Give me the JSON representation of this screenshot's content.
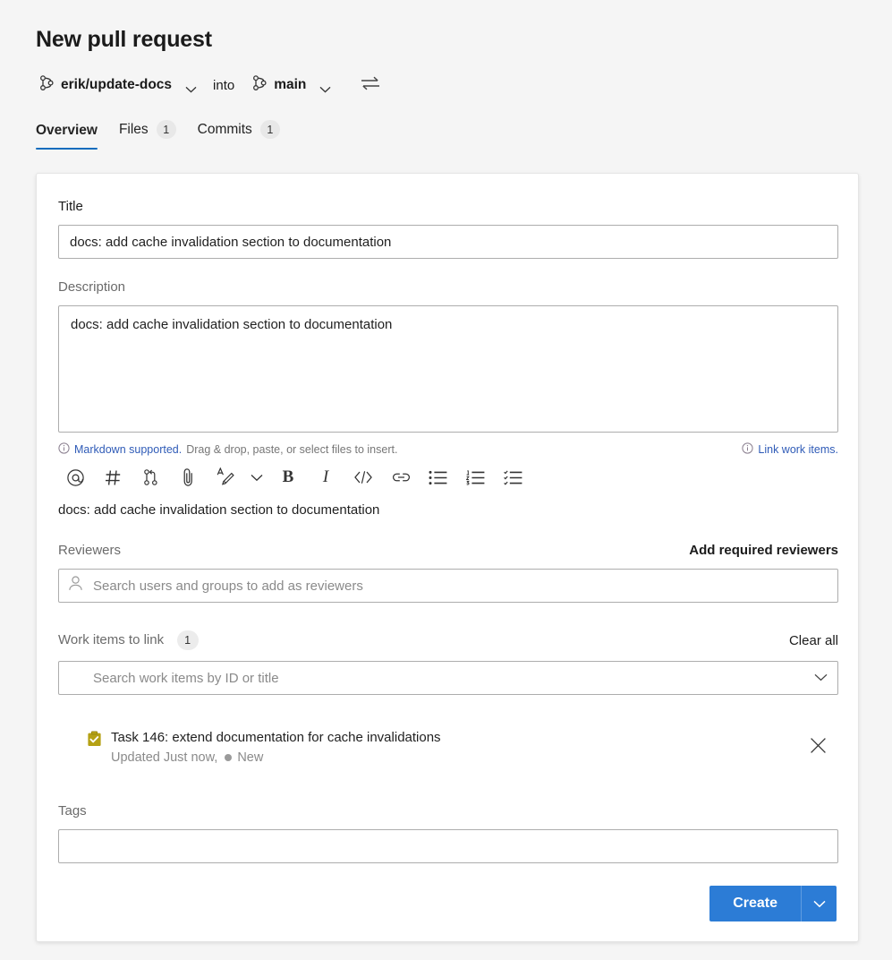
{
  "header": {
    "title": "New pull request",
    "source_branch": "erik/update-docs",
    "into_label": "into",
    "target_branch": "main",
    "source_icon": "branch-icon",
    "target_icon": "branch-icon",
    "swap_icon": "swap-arrows-icon"
  },
  "tabs": [
    {
      "label": "Overview",
      "count": "",
      "active": true
    },
    {
      "label": "Files",
      "count": "1",
      "active": false
    },
    {
      "label": "Commits",
      "count": "1",
      "active": false
    }
  ],
  "form": {
    "title_label": "Title",
    "title_value": "docs: add cache invalidation section to documentation",
    "description_label": "Description",
    "description_value": "docs: add cache invalidation section to documentation",
    "description_preview": "docs: add cache invalidation section to documentation",
    "markdown_link": "Markdown supported.",
    "markdown_hint": "Drag & drop, paste, or select files to insert.",
    "link_work_items": "Link work items.",
    "toolbar": [
      {
        "name": "mention-icon",
        "glyph": "@"
      },
      {
        "name": "hashtag-icon",
        "glyph": "#"
      },
      {
        "name": "pull-request-icon",
        "glyph": ""
      },
      {
        "name": "attachment-icon",
        "glyph": ""
      },
      {
        "name": "highlight-icon",
        "glyph": ""
      },
      {
        "name": "chevron-down-icon",
        "glyph": ""
      },
      {
        "name": "bold-icon",
        "glyph": "B"
      },
      {
        "name": "italic-icon",
        "glyph": "I"
      },
      {
        "name": "code-icon",
        "glyph": ""
      },
      {
        "name": "link-icon",
        "glyph": ""
      },
      {
        "name": "bulleted-list-icon",
        "glyph": ""
      },
      {
        "name": "numbered-list-icon",
        "glyph": ""
      },
      {
        "name": "task-list-icon",
        "glyph": ""
      }
    ],
    "reviewers_label": "Reviewers",
    "add_required_reviewers": "Add required reviewers",
    "reviewers_placeholder": "Search users and groups to add as reviewers",
    "work_items_label": "Work items to link",
    "work_items_count": "1",
    "clear_all": "Clear all",
    "work_items_placeholder": "Search work items by ID or title",
    "linked_work_items": [
      {
        "icon": "task-clipboard-icon",
        "icon_color": "#b5a114",
        "title": "Task 146: extend documentation for cache invalidations",
        "updated": "Updated Just now,",
        "state": "New",
        "remove_icon": "close-icon"
      }
    ],
    "tags_label": "Tags",
    "tags_value": "",
    "create_label": "Create",
    "create_chevron_icon": "chevron-down-icon"
  },
  "colors": {
    "accent": "#0f6cbd",
    "primary_button": "#2c7cd6",
    "link": "#2f5bb7",
    "page_background": "#f5f5f5"
  }
}
